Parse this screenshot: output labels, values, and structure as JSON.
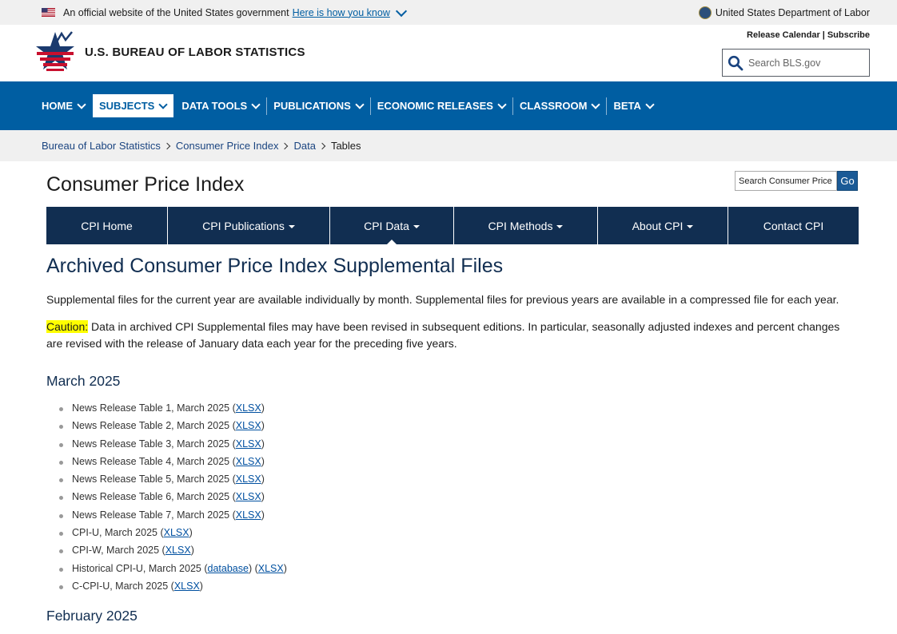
{
  "gov_banner": {
    "official_text": "An official website of the United States government",
    "how_link": "Here is how you know",
    "dept": "United States Department of Labor"
  },
  "header": {
    "title": "U.S. BUREAU OF LABOR STATISTICS",
    "release_calendar": "Release Calendar",
    "subscribe": "Subscribe",
    "search_placeholder": "Search BLS.gov"
  },
  "main_nav": [
    {
      "label": "HOME"
    },
    {
      "label": "SUBJECTS",
      "active": true
    },
    {
      "label": "DATA TOOLS"
    },
    {
      "label": "PUBLICATIONS"
    },
    {
      "label": "ECONOMIC RELEASES"
    },
    {
      "label": "CLASSROOM"
    },
    {
      "label": "BETA"
    }
  ],
  "breadcrumb": [
    "Bureau of Labor Statistics",
    "Consumer Price Index",
    "Data",
    "Tables"
  ],
  "page": {
    "title": "Consumer Price Index",
    "search_placeholder": "Search Consumer Price Index",
    "go_label": "Go"
  },
  "subnav": [
    {
      "label": "CPI Home"
    },
    {
      "label": "CPI Publications"
    },
    {
      "label": "CPI Data"
    },
    {
      "label": "CPI Methods"
    },
    {
      "label": "About CPI"
    },
    {
      "label": "Contact CPI"
    }
  ],
  "content": {
    "heading": "Archived Consumer Price Index Supplemental Files",
    "intro": "Supplemental files for the current year are available individually by month. Supplemental files for previous years are available in a compressed file for each year.",
    "caution_label": "Caution:",
    "caution_text": " Data in archived CPI Supplemental files may have been revised in subsequent editions. In particular, seasonally adjusted indexes and percent changes are revised with the release of January data each year for the preceding five years.",
    "march_heading": "March 2025",
    "feb_heading": "February 2025",
    "march_files": [
      {
        "label": "News Release Table 1, March 2025",
        "links": [
          "XLSX"
        ]
      },
      {
        "label": "News Release Table 2, March 2025",
        "links": [
          "XLSX"
        ]
      },
      {
        "label": "News Release Table 3, March 2025",
        "links": [
          "XLSX"
        ]
      },
      {
        "label": "News Release Table 4, March 2025",
        "links": [
          "XLSX"
        ]
      },
      {
        "label": "News Release Table 5, March 2025",
        "links": [
          "XLSX"
        ]
      },
      {
        "label": "News Release Table 6, March 2025",
        "links": [
          "XLSX"
        ]
      },
      {
        "label": "News Release Table 7, March 2025",
        "links": [
          "XLSX"
        ]
      },
      {
        "label": "CPI-U, March 2025",
        "links": [
          "XLSX"
        ]
      },
      {
        "label": "CPI-W, March 2025",
        "links": [
          "XLSX"
        ]
      },
      {
        "label": "Historical CPI-U, March 2025",
        "links": [
          "database",
          "XLSX"
        ]
      },
      {
        "label": "C-CPI-U, March 2025",
        "links": [
          "XLSX"
        ]
      }
    ]
  },
  "colors": {
    "nav_blue": "#005ea2",
    "subnav_navy": "#112e51",
    "heading_navy": "#112e51",
    "caution_highlight": "#ffff00"
  },
  "icons": [
    "us-flag-icon",
    "chevron-down-icon",
    "dol-seal-icon",
    "bls-star-logo",
    "search-icon",
    "breadcrumb-chevron-icon",
    "dropdown-caret-icon"
  ]
}
